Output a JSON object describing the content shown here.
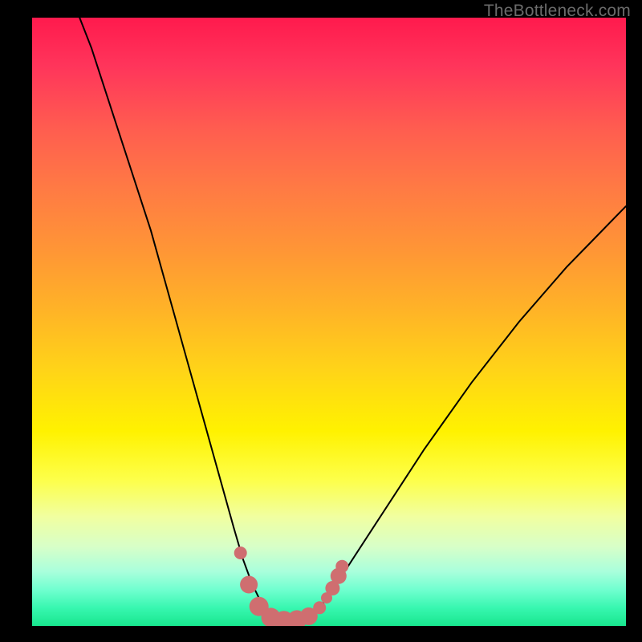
{
  "watermark": {
    "text": "TheBottleneck.com"
  },
  "chart_data": {
    "type": "line",
    "title": "",
    "xlabel": "",
    "ylabel": "",
    "xlim": [
      0,
      100
    ],
    "ylim": [
      0,
      100
    ],
    "grid": false,
    "legend": false,
    "series": [
      {
        "name": "bottleneck-curve",
        "x": [
          8,
          10,
          12,
          14,
          16,
          18,
          20,
          22,
          24,
          26,
          28,
          30,
          32,
          34,
          35.5,
          37,
          38.5,
          40,
          42,
          44,
          46,
          48,
          50,
          54,
          58,
          62,
          66,
          70,
          74,
          78,
          82,
          86,
          90,
          94,
          98,
          100
        ],
        "y": [
          100,
          95,
          89,
          83,
          77,
          71,
          65,
          58,
          51,
          44,
          37,
          30,
          23,
          16,
          11,
          7,
          4,
          2,
          1,
          0.5,
          1,
          2.5,
          5,
          11,
          17,
          23,
          29,
          34.5,
          40,
          45,
          50,
          54.5,
          59,
          63,
          67,
          69
        ],
        "color": "#000000",
        "linewidth": 2
      }
    ],
    "markers": {
      "name": "highlighted-points",
      "color": "#cf6e70",
      "radius_seq": [
        8,
        11,
        12,
        12,
        12,
        12,
        11,
        8,
        7,
        9,
        10,
        8
      ],
      "points": [
        {
          "x": 35.1,
          "y": 12.0
        },
        {
          "x": 36.5,
          "y": 6.8
        },
        {
          "x": 38.2,
          "y": 3.2
        },
        {
          "x": 40.2,
          "y": 1.4
        },
        {
          "x": 42.4,
          "y": 0.9
        },
        {
          "x": 44.6,
          "y": 1.0
        },
        {
          "x": 46.6,
          "y": 1.6
        },
        {
          "x": 48.4,
          "y": 3.0
        },
        {
          "x": 49.6,
          "y": 4.6
        },
        {
          "x": 50.6,
          "y": 6.2
        },
        {
          "x": 51.6,
          "y": 8.2
        },
        {
          "x": 52.2,
          "y": 9.8
        }
      ]
    },
    "background": {
      "type": "vertical-gradient",
      "stops": [
        {
          "pos": 0.0,
          "color": "#ff1a4d"
        },
        {
          "pos": 0.4,
          "color": "#ff9536"
        },
        {
          "pos": 0.68,
          "color": "#fff200"
        },
        {
          "pos": 0.88,
          "color": "#d7ffc8"
        },
        {
          "pos": 1.0,
          "color": "#18e68e"
        }
      ]
    }
  }
}
